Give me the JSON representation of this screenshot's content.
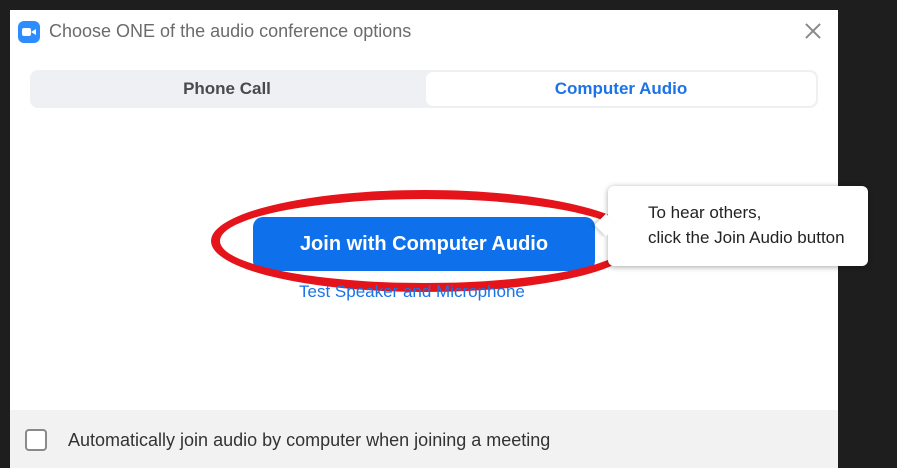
{
  "window": {
    "title": "Choose ONE of the audio conference options",
    "app_icon": "zoom-camera-icon",
    "close_icon": "close-icon"
  },
  "tabs": [
    {
      "label": "Phone Call",
      "selected": false
    },
    {
      "label": "Computer Audio",
      "selected": true
    }
  ],
  "main": {
    "join_button_label": "Join with Computer Audio",
    "test_link_label": "Test Speaker and Microphone"
  },
  "tooltip": {
    "line1": "To hear others,",
    "line2": "click the Join Audio button"
  },
  "footer": {
    "checkbox_label": "Automatically join audio by computer when joining a meeting",
    "checkbox_checked": false
  },
  "colors": {
    "accent": "#0e71eb",
    "link": "#1a73e8",
    "highlight_oval": "#e5141b"
  }
}
